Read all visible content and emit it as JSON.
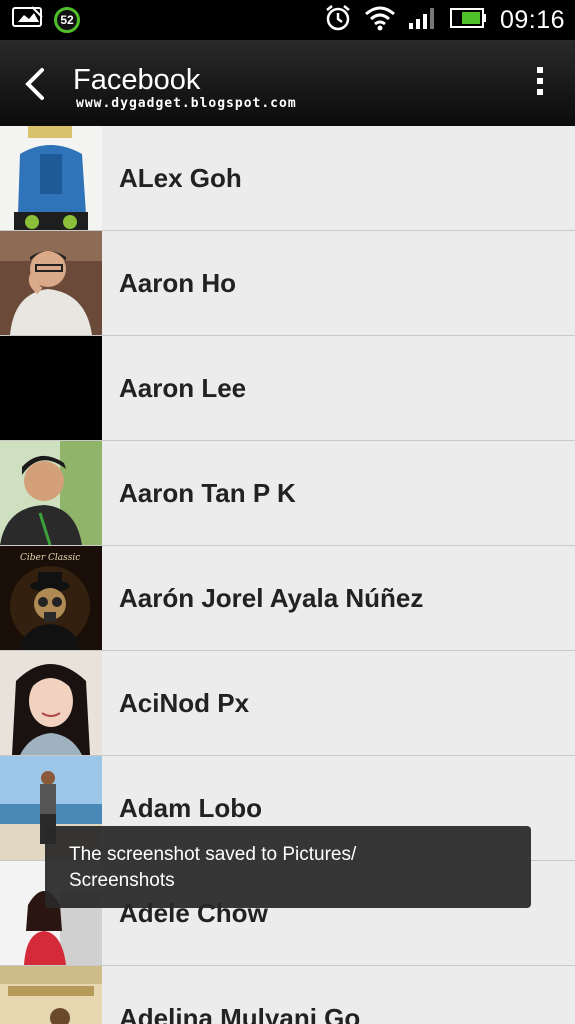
{
  "status_bar": {
    "notification_badge": "52",
    "time": "09:16",
    "icons": [
      "screenshot-icon",
      "alarm-icon",
      "wifi-icon",
      "signal-icon",
      "battery-icon"
    ]
  },
  "header": {
    "title": "Facebook",
    "watermark": "www.dygadget.blogspot.com"
  },
  "contacts": [
    {
      "name": "ALex Goh"
    },
    {
      "name": "Aaron Ho"
    },
    {
      "name": "Aaron Lee"
    },
    {
      "name": "Aaron Tan P K"
    },
    {
      "name": "Aarón Jorel Ayala Núñez",
      "avatar_caption": "Ciber Classic"
    },
    {
      "name": "AciNod Px"
    },
    {
      "name": "Adam Lobo"
    },
    {
      "name": "Adele Chow"
    },
    {
      "name": "Adelina Mulyani Go"
    }
  ],
  "toast": {
    "line1": "The screenshot saved to Pictures/",
    "line2": "Screenshots"
  },
  "colors": {
    "list_background": "#ececec",
    "header_background": "#141414",
    "accent_green": "#4fbf2a"
  }
}
